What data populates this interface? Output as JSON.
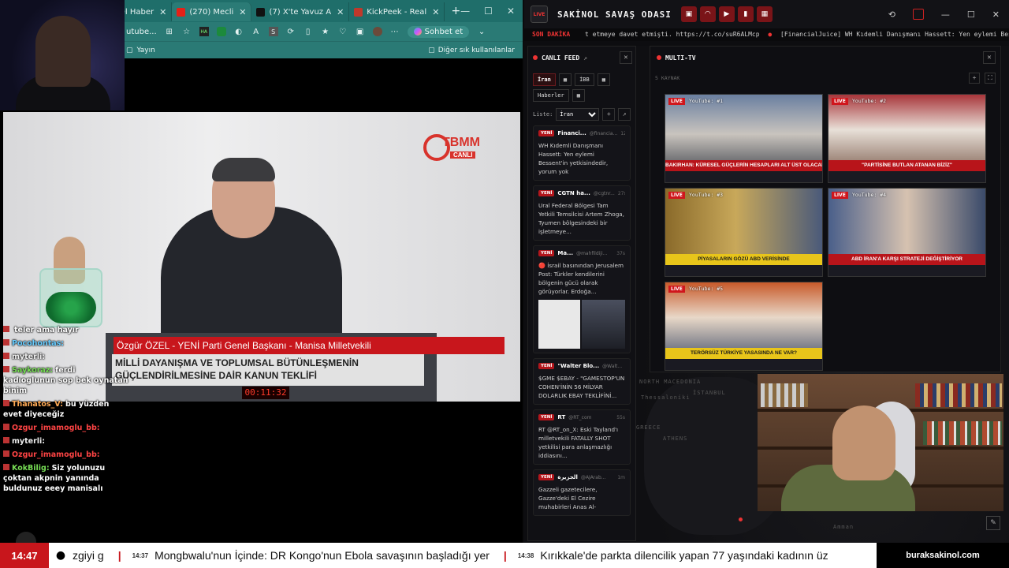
{
  "browser": {
    "tabs": [
      {
        "label": "SakinOl Haber",
        "color": "#3b5fcf"
      },
      {
        "label": "(270) Mecli",
        "color": "#e62117",
        "active": true
      },
      {
        "label": "(7) X'te Yavuz A",
        "color": "#111111"
      },
      {
        "label": "KickPeek - Real",
        "color": "#c0392b"
      }
    ],
    "new_tab": "+",
    "address": "utube...",
    "profile_label": "Sohbet et",
    "bookmark": "Yayın",
    "other_bookmarks": "Diğer sık kullanılanlar"
  },
  "video": {
    "channel_logo": "TBMM",
    "channel_sub": "CANLI",
    "lower_name": "Özgür ÖZEL - YENİ Parti Genel Başkanı - Manisa Milletvekili",
    "lower_title_1": "MİLLİ DAYANIŞMA VE TOPLUMSAL BÜTÜNLEŞMENİN",
    "lower_title_2": "GÜÇLENDİRİLMESİNE DAİR KANUN TEKLİFİ",
    "timer": "00:11:32"
  },
  "chat": [
    {
      "user": "",
      "text": "teler ama hayır",
      "color": "#9ad"
    },
    {
      "user": "Pocohontas:",
      "text": "",
      "color": "#6cf"
    },
    {
      "user": "myterli:",
      "text": "",
      "color": "#eee"
    },
    {
      "user": "Saykoraz:",
      "text": "ferdi kadıoglunun sop bek oynatan binim",
      "color": "#7d5"
    },
    {
      "user": "Thanatos_V:",
      "text": "bu yüzden evet diyeceğiz",
      "color": "#fa5"
    },
    {
      "user": "Ozgur_imamoglu_bb:",
      "text": "",
      "color": "#f44"
    },
    {
      "user": "myterli:",
      "text": "",
      "color": "#eee"
    },
    {
      "user": "Ozgur_imamoglu_bb:",
      "text": "",
      "color": "#f44"
    },
    {
      "user": "KokBilig:",
      "text": "Siz yolunuzu çoktan akpnin yanında buldunuz eeey manisalı",
      "color": "#7d5"
    }
  ],
  "app": {
    "title": "SAKİNOL SAVAŞ ODASI",
    "logo_text": "LIVE",
    "ticker_label": "SON DAKİKA",
    "ticker_text": "t etmeye davet etmişti. https://t.co/suR6ALMcp",
    "ticker_text2": "[FinancialJuice] WH Kıdemli Danışmanı Hassett: Yen eylemi Bessent'in yetkisindedir, yo"
  },
  "feed": {
    "title": "CANLI FEED",
    "tabs": [
      "İran",
      "İBB",
      "Haberler"
    ],
    "list_label": "Liste:",
    "list_value": "İran",
    "items": [
      {
        "badge": "YENİ",
        "source": "Financi...",
        "handle": "@financia...",
        "age": "12s",
        "body": "WH Kıdemli Danışmanı Hassett: Yen eylemi Bessent'in yetkisindedir, yorum yok"
      },
      {
        "badge": "YENİ",
        "source": "CGTN ha...",
        "handle": "@cgtnr...",
        "age": "27s",
        "body": "Ural Federal Bölgesi Tam Yetkili Temsilcisi Artem Zhoga, Tyumen bölgesindeki bir işletmeye..."
      },
      {
        "badge": "YENİ",
        "source": "Ma...",
        "handle": "@mahfildiji...",
        "age": "37s",
        "body": "🔴 İsrail basınından Jerusalem Post: Türkler kendilerini bölgenin gücü olarak görüyorlar. Erdoğa...",
        "image": true
      },
      {
        "badge": "YENİ",
        "source": "\"Walter Blo...",
        "handle": "@Walt...",
        "age": "42s",
        "body": "$GME $EBAY - \"GAMESTOP'UN COHEN'İNİN 56 MİLYAR DOLARLIK EBAY TEKLİFİNİ..."
      },
      {
        "badge": "YENİ",
        "source": "RT",
        "handle": "@RT_com",
        "age": "55s",
        "body": "RT @RT_on_X: Eski Tayland'ı milletvekili FATALLY SHOT yetkilisi para anlaşmazlığı iddiasını..."
      },
      {
        "badge": "YENİ",
        "source": "الجزيرة",
        "handle": "@AJArab...",
        "age": "1m",
        "body": "Gazzeli gazetecilere, Gazze'deki El Cezire muhabirleri Anas Al-"
      }
    ]
  },
  "multitv": {
    "title": "MULTI-TV",
    "subtitle": "5 KAYNAK",
    "tiles": [
      {
        "live": "LIVE",
        "label": "YouTube: #1",
        "headline": "BAKIRHAN: KÜRESEL GÜÇLERİN HESAPLARI ALT ÜST OLACAK",
        "bar": "red"
      },
      {
        "live": "LIVE",
        "label": "YouTube: #2",
        "headline": "\"PARTİSİNE BUTLAN ATANAN BİZİZ\"",
        "bar": "red"
      },
      {
        "live": "LIVE",
        "label": "YouTube: #3",
        "headline": "PİYASALARIN GÖZÜ ABD VERİSİNDE",
        "bar": "yellow"
      },
      {
        "live": "LIVE",
        "label": "YouTube: #4",
        "headline": "ABD İRAN'A KARŞI STRATEJİ DEĞİŞTİRİYOR",
        "bar": "red"
      },
      {
        "live": "LIVE",
        "label": "YouTube: #5",
        "headline": "TERÖRSÜZ TÜRKİYE YASASINDA NE VAR?",
        "bar": "yellow"
      }
    ]
  },
  "map_labels": [
    "NORTH MACEDONIA",
    "Thessaloníki",
    "GREECE",
    "ATHENS",
    "İSTANBUL",
    "Amman"
  ],
  "bottom_ticker": {
    "time": "14:47",
    "items": [
      {
        "time": "",
        "text": "zgiyi g"
      },
      {
        "time": "14:37",
        "text": "Mongbwalu'nun İçinde: DR Kongo'nun Ebola savaşının başladığı yer"
      },
      {
        "time": "14:38",
        "text": "Kırıkkale'de parkta dilencilik yapan 77 yaşındaki kadının üz"
      }
    ],
    "site": "buraksakinol.com"
  }
}
